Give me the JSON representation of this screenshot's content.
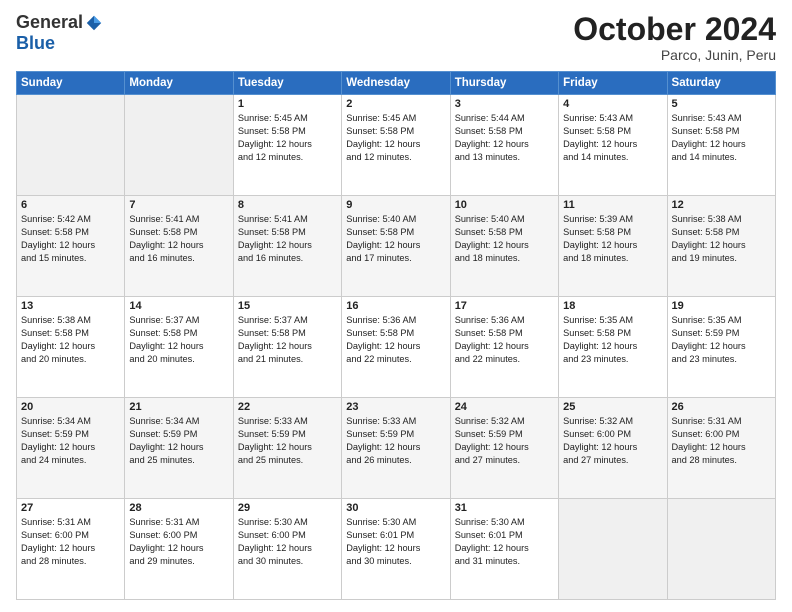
{
  "logo": {
    "general": "General",
    "blue": "Blue"
  },
  "header": {
    "month": "October 2024",
    "location": "Parco, Junin, Peru"
  },
  "weekdays": [
    "Sunday",
    "Monday",
    "Tuesday",
    "Wednesday",
    "Thursday",
    "Friday",
    "Saturday"
  ],
  "weeks": [
    [
      {
        "day": "",
        "content": ""
      },
      {
        "day": "",
        "content": ""
      },
      {
        "day": "1",
        "content": "Sunrise: 5:45 AM\nSunset: 5:58 PM\nDaylight: 12 hours\nand 12 minutes."
      },
      {
        "day": "2",
        "content": "Sunrise: 5:45 AM\nSunset: 5:58 PM\nDaylight: 12 hours\nand 12 minutes."
      },
      {
        "day": "3",
        "content": "Sunrise: 5:44 AM\nSunset: 5:58 PM\nDaylight: 12 hours\nand 13 minutes."
      },
      {
        "day": "4",
        "content": "Sunrise: 5:43 AM\nSunset: 5:58 PM\nDaylight: 12 hours\nand 14 minutes."
      },
      {
        "day": "5",
        "content": "Sunrise: 5:43 AM\nSunset: 5:58 PM\nDaylight: 12 hours\nand 14 minutes."
      }
    ],
    [
      {
        "day": "6",
        "content": "Sunrise: 5:42 AM\nSunset: 5:58 PM\nDaylight: 12 hours\nand 15 minutes."
      },
      {
        "day": "7",
        "content": "Sunrise: 5:41 AM\nSunset: 5:58 PM\nDaylight: 12 hours\nand 16 minutes."
      },
      {
        "day": "8",
        "content": "Sunrise: 5:41 AM\nSunset: 5:58 PM\nDaylight: 12 hours\nand 16 minutes."
      },
      {
        "day": "9",
        "content": "Sunrise: 5:40 AM\nSunset: 5:58 PM\nDaylight: 12 hours\nand 17 minutes."
      },
      {
        "day": "10",
        "content": "Sunrise: 5:40 AM\nSunset: 5:58 PM\nDaylight: 12 hours\nand 18 minutes."
      },
      {
        "day": "11",
        "content": "Sunrise: 5:39 AM\nSunset: 5:58 PM\nDaylight: 12 hours\nand 18 minutes."
      },
      {
        "day": "12",
        "content": "Sunrise: 5:38 AM\nSunset: 5:58 PM\nDaylight: 12 hours\nand 19 minutes."
      }
    ],
    [
      {
        "day": "13",
        "content": "Sunrise: 5:38 AM\nSunset: 5:58 PM\nDaylight: 12 hours\nand 20 minutes."
      },
      {
        "day": "14",
        "content": "Sunrise: 5:37 AM\nSunset: 5:58 PM\nDaylight: 12 hours\nand 20 minutes."
      },
      {
        "day": "15",
        "content": "Sunrise: 5:37 AM\nSunset: 5:58 PM\nDaylight: 12 hours\nand 21 minutes."
      },
      {
        "day": "16",
        "content": "Sunrise: 5:36 AM\nSunset: 5:58 PM\nDaylight: 12 hours\nand 22 minutes."
      },
      {
        "day": "17",
        "content": "Sunrise: 5:36 AM\nSunset: 5:58 PM\nDaylight: 12 hours\nand 22 minutes."
      },
      {
        "day": "18",
        "content": "Sunrise: 5:35 AM\nSunset: 5:58 PM\nDaylight: 12 hours\nand 23 minutes."
      },
      {
        "day": "19",
        "content": "Sunrise: 5:35 AM\nSunset: 5:59 PM\nDaylight: 12 hours\nand 23 minutes."
      }
    ],
    [
      {
        "day": "20",
        "content": "Sunrise: 5:34 AM\nSunset: 5:59 PM\nDaylight: 12 hours\nand 24 minutes."
      },
      {
        "day": "21",
        "content": "Sunrise: 5:34 AM\nSunset: 5:59 PM\nDaylight: 12 hours\nand 25 minutes."
      },
      {
        "day": "22",
        "content": "Sunrise: 5:33 AM\nSunset: 5:59 PM\nDaylight: 12 hours\nand 25 minutes."
      },
      {
        "day": "23",
        "content": "Sunrise: 5:33 AM\nSunset: 5:59 PM\nDaylight: 12 hours\nand 26 minutes."
      },
      {
        "day": "24",
        "content": "Sunrise: 5:32 AM\nSunset: 5:59 PM\nDaylight: 12 hours\nand 27 minutes."
      },
      {
        "day": "25",
        "content": "Sunrise: 5:32 AM\nSunset: 6:00 PM\nDaylight: 12 hours\nand 27 minutes."
      },
      {
        "day": "26",
        "content": "Sunrise: 5:31 AM\nSunset: 6:00 PM\nDaylight: 12 hours\nand 28 minutes."
      }
    ],
    [
      {
        "day": "27",
        "content": "Sunrise: 5:31 AM\nSunset: 6:00 PM\nDaylight: 12 hours\nand 28 minutes."
      },
      {
        "day": "28",
        "content": "Sunrise: 5:31 AM\nSunset: 6:00 PM\nDaylight: 12 hours\nand 29 minutes."
      },
      {
        "day": "29",
        "content": "Sunrise: 5:30 AM\nSunset: 6:00 PM\nDaylight: 12 hours\nand 30 minutes."
      },
      {
        "day": "30",
        "content": "Sunrise: 5:30 AM\nSunset: 6:01 PM\nDaylight: 12 hours\nand 30 minutes."
      },
      {
        "day": "31",
        "content": "Sunrise: 5:30 AM\nSunset: 6:01 PM\nDaylight: 12 hours\nand 31 minutes."
      },
      {
        "day": "",
        "content": ""
      },
      {
        "day": "",
        "content": ""
      }
    ]
  ]
}
